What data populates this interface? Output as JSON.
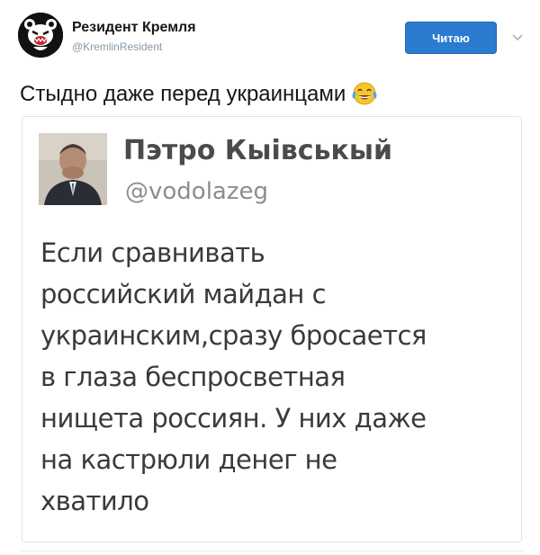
{
  "tweet": {
    "author": {
      "name": "Резидент Кремля",
      "handle": "@KremlinResident"
    },
    "follow_label": "Читаю",
    "text": "Стыдно даже перед украинцами",
    "emoji": "tears-of-joy-emoji"
  },
  "embedded": {
    "author": {
      "name": "Пэтро Кыівськый",
      "handle": "@vodolazeg"
    },
    "lines": [
      "Если сравнивать",
      "российский майдан с",
      "украинским,сразу бросается",
      "в глаза беспросветная",
      "нищета россиян. У них даже",
      "на кастрюли денег не",
      "хватило"
    ]
  },
  "colors": {
    "follow_button": "#2b7bd0",
    "handle_gray": "#8899a6",
    "embed_name": "#4b4b4b",
    "embed_text": "#3a3a3a"
  }
}
